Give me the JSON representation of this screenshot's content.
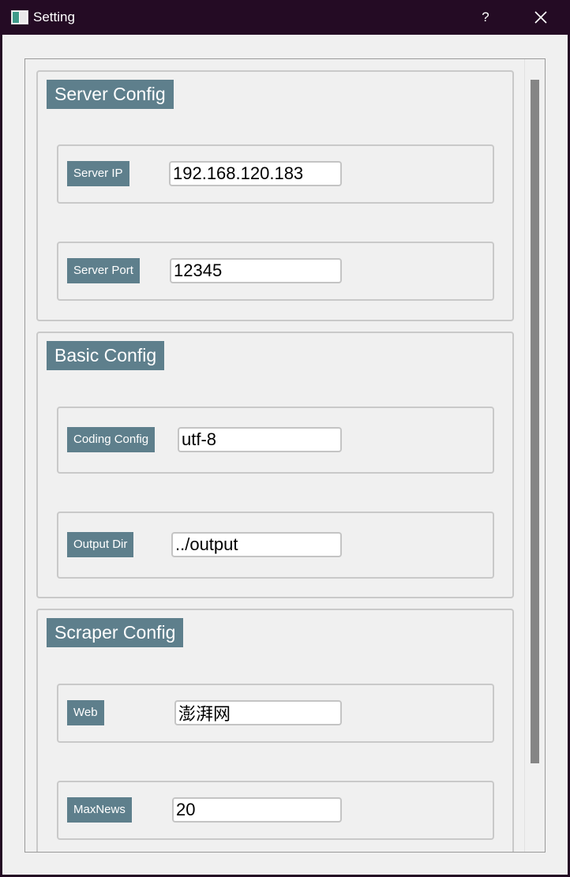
{
  "window": {
    "title": "Setting",
    "help_label": "?"
  },
  "groups": [
    {
      "title": "Server Config",
      "rows": [
        {
          "label": "Server IP",
          "value": "192.168.120.183"
        },
        {
          "label": "Server Port",
          "value": "12345"
        }
      ]
    },
    {
      "title": "Basic Config",
      "rows": [
        {
          "label": "Coding Config",
          "value": "utf-8"
        },
        {
          "label": "Output Dir",
          "value": "../output"
        }
      ]
    },
    {
      "title": "Scraper Config",
      "rows": [
        {
          "label": "Web",
          "value": "澎湃网"
        },
        {
          "label": "MaxNews",
          "value": "20"
        }
      ]
    }
  ],
  "colors": {
    "titlebar": "#240b24",
    "badge": "#5e7f8c",
    "background": "#f0f0f0",
    "scroll_thumb": "#858585"
  },
  "icons": {
    "app": "window-app-icon",
    "close": "close-icon"
  }
}
